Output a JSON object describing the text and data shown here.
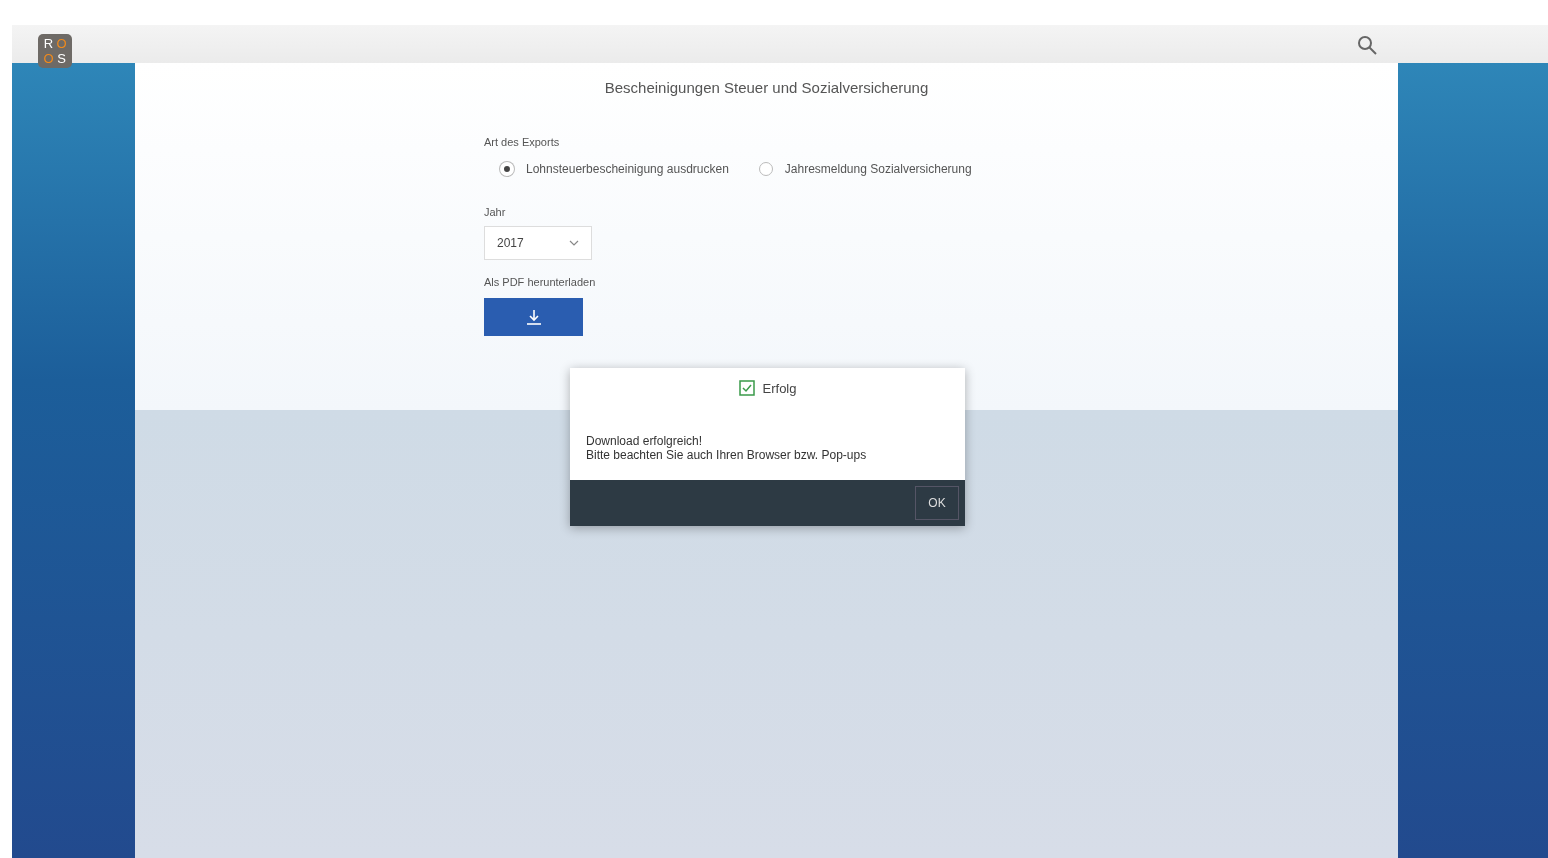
{
  "header": {
    "logo": {
      "letters": [
        {
          "char": "R",
          "accent": false
        },
        {
          "char": "O",
          "accent": true
        },
        {
          "char": "O",
          "accent": true
        },
        {
          "char": "S",
          "accent": false
        }
      ]
    }
  },
  "page": {
    "title": "Bescheinigungen Steuer und Sozialversicherung",
    "export_type": {
      "label": "Art des Exports",
      "options": [
        {
          "label": "Lohnsteuerbescheinigung ausdrucken",
          "selected": true
        },
        {
          "label": "Jahresmeldung Sozialversicherung",
          "selected": false
        }
      ]
    },
    "year": {
      "label": "Jahr",
      "value": "2017"
    },
    "download": {
      "label": "Als PDF herunterladen"
    }
  },
  "dialog": {
    "title": "Erfolg",
    "lines": [
      "Download erfolgreich!",
      "Bitte beachten Sie auch Ihren Browser bzw. Pop-ups"
    ],
    "button": "OK"
  }
}
